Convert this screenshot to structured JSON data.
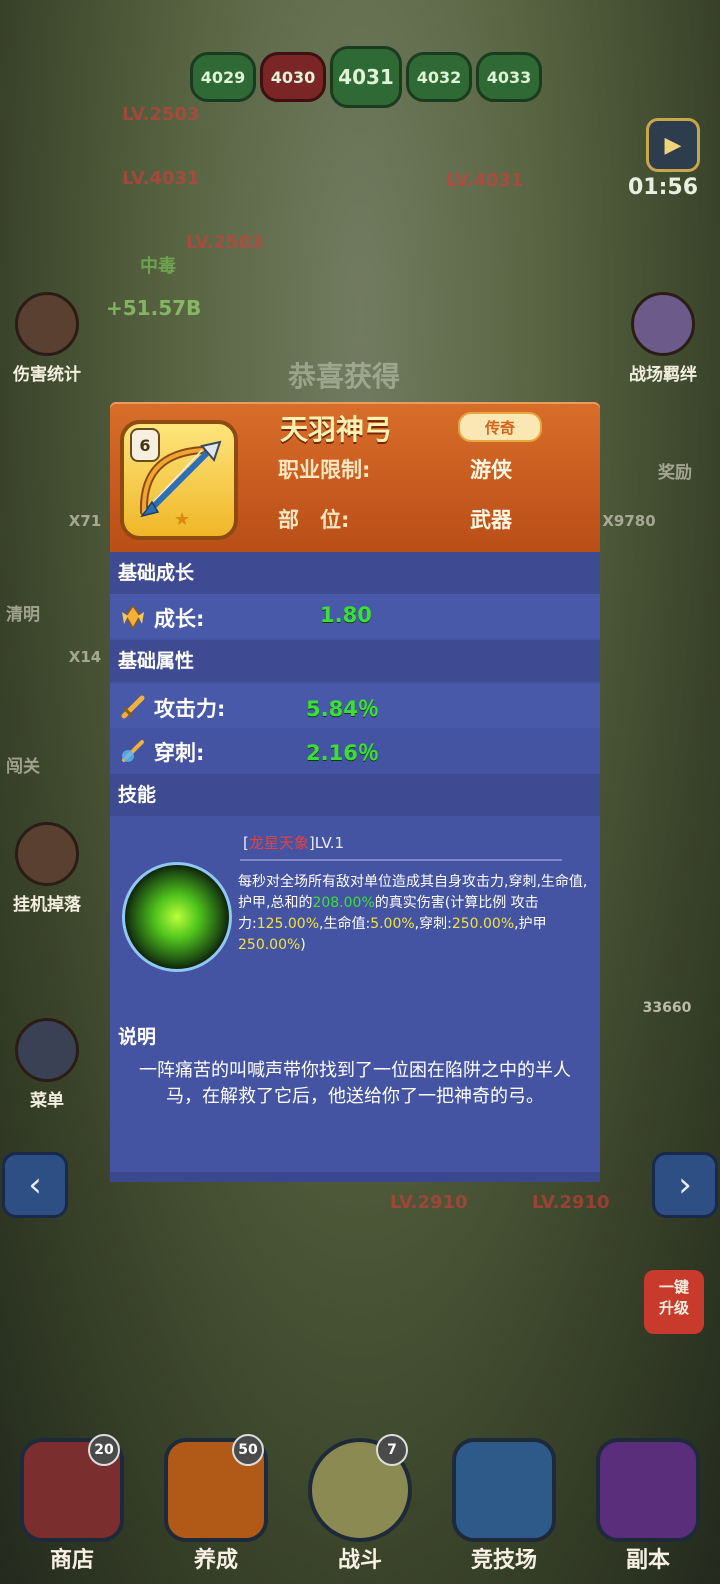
{
  "hud": {
    "levels": [
      "4029",
      "4030",
      "4031",
      "4032",
      "4033"
    ],
    "timer": "01:56",
    "left_buttons": [
      "伤害统计",
      "清明",
      "闯关",
      "挂机掉落",
      "菜单"
    ],
    "right_buttons": [
      "战场羁绊"
    ],
    "hero_levels": [
      "LV.2503",
      "LV.4031",
      "LV.2503",
      "LV.4031",
      "LV.2910",
      "LV.2910"
    ],
    "poison_text": "中毒",
    "damage_text": "+51.57B",
    "congrats_text": "恭喜获得",
    "counts": [
      "X71",
      "X9780",
      "X14",
      "33660"
    ],
    "reward_label": "奖励",
    "upgrade_label": "一键\n升级"
  },
  "item": {
    "name": "天羽神弓",
    "rarity": "传奇",
    "lock_level": "6",
    "class_label": "职业限制:",
    "class_value": "游侠",
    "slot_label": "部　位:",
    "slot_value": "武器"
  },
  "sections": {
    "growth_title": "基础成长",
    "attr_title": "基础属性",
    "skill_title": "技能",
    "note_title": "说明"
  },
  "growth": {
    "label": "成长:",
    "value": "1.80"
  },
  "attributes": [
    {
      "label": "攻击力:",
      "value": "5.84％"
    },
    {
      "label": "穿刺:",
      "value": "2.16％"
    }
  ],
  "skill": {
    "name": "龙星天象",
    "level": "LV.1",
    "desc_1": "每秒对全场所有敌对单位造成其自身攻击力,穿刺,生命值,护甲,总和的",
    "desc_pct": "208.00%",
    "desc_2": "的真实伤害(计算比例 攻击力:",
    "atk": "125.00%",
    "hp_label": ",生命值:",
    "hp": "5.00%",
    "pierce_label": ",穿刺:",
    "pierce": "250.00%",
    "armor_label": ",护甲",
    "armor": "250.00%",
    "end": ")"
  },
  "description": "一阵痛苦的叫喊声带你找到了一位困在陷阱之中的半人马，在解救了它后，他送给你了一把神奇的弓。",
  "nav": [
    {
      "label": "商店",
      "badge": "20"
    },
    {
      "label": "养成",
      "badge": "50"
    },
    {
      "label": "战斗",
      "badge": "7"
    },
    {
      "label": "竞技场",
      "badge": ""
    },
    {
      "label": "副本",
      "badge": ""
    }
  ],
  "colors": {
    "header_orange": "#c65a1f",
    "body_blue": "#4454a3",
    "value_green": "#3be036",
    "highlight_yellow": "#f2e33c",
    "skill_name_red": "#e34242"
  }
}
